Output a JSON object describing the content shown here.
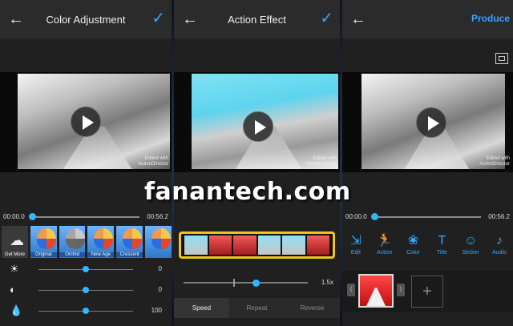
{
  "screens": {
    "color": {
      "title": "Color Adjustment",
      "back": "←",
      "confirm": "✓",
      "time_start": "00:00.0",
      "time_end": "00:56.2",
      "filters": [
        {
          "label": "Get More",
          "kind": "more"
        },
        {
          "label": "Original",
          "kind": "color"
        },
        {
          "label": "Orchid",
          "kind": "color"
        },
        {
          "label": "New Age",
          "kind": "color"
        },
        {
          "label": "Crescent",
          "kind": "color"
        },
        {
          "label": "",
          "kind": "color"
        }
      ],
      "adjustments": [
        {
          "icon": "brightness-icon",
          "glyph": "☀",
          "value": "0",
          "level": 0.5
        },
        {
          "icon": "contrast-icon",
          "glyph": "◐",
          "value": "0",
          "level": 0.5
        },
        {
          "icon": "saturation-icon",
          "glyph": "💧",
          "value": "100",
          "level": 0.5
        }
      ]
    },
    "action": {
      "title": "Action Effect",
      "back": "←",
      "confirm": "✓",
      "speed_value": "1.5x",
      "speed_level": 0.58,
      "tabs": [
        "Speed",
        "Repeat",
        "Reverse"
      ],
      "active_tab": "Speed"
    },
    "produce": {
      "back": "←",
      "produce": "Produce",
      "time_start": "00:00.0",
      "time_end": "00:56.2",
      "tools": [
        {
          "label": "Edit",
          "icon": "edit-icon",
          "glyph": "⇲"
        },
        {
          "label": "Action",
          "icon": "action-icon",
          "glyph": "🏃"
        },
        {
          "label": "Color",
          "icon": "color-icon",
          "glyph": "❀"
        },
        {
          "label": "Title",
          "icon": "title-icon",
          "glyph": "T"
        },
        {
          "label": "Sticker",
          "icon": "sticker-icon",
          "glyph": "☺"
        },
        {
          "label": "Audio",
          "icon": "audio-icon",
          "glyph": "♪"
        }
      ],
      "add_clip": "+"
    }
  },
  "video_watermark": {
    "line1": "Edited with",
    "line2": "ActionDirector"
  },
  "site_watermark": "fanantech.com",
  "colors": {
    "accent": "#2fb8ff",
    "strip_border": "#f0c419"
  }
}
